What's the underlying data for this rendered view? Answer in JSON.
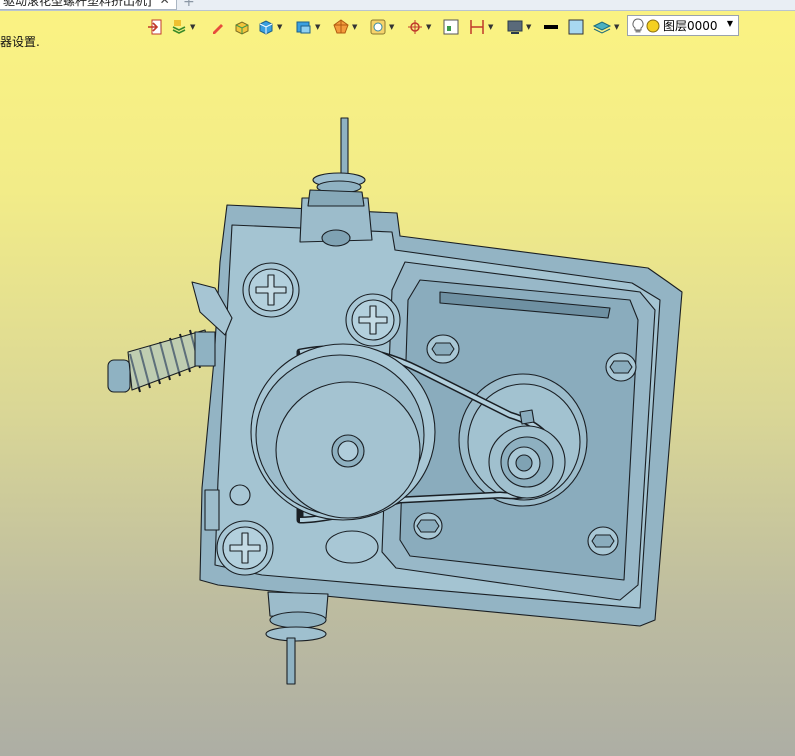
{
  "tab": {
    "title": "驱动滚花型螺杆塑料挤出机]",
    "close": "✕",
    "add": "+"
  },
  "status_text": "器设置.",
  "layer": {
    "name": "图层0000"
  },
  "toolbar": {
    "icons": [
      "exit-icon",
      "layers-icon",
      "pen-icon",
      "box-icon",
      "cube-icon",
      "render-icon",
      "section-icon",
      "view-icon",
      "snap-icon",
      "frame-icon",
      "dimension-icon",
      "display-icon",
      "line-style-icon",
      "fill-color-icon",
      "surface-icon"
    ]
  },
  "colors": {
    "accent": "#8fb2c2",
    "background_top": "#fbf382",
    "background_bottom": "#adaea4"
  }
}
